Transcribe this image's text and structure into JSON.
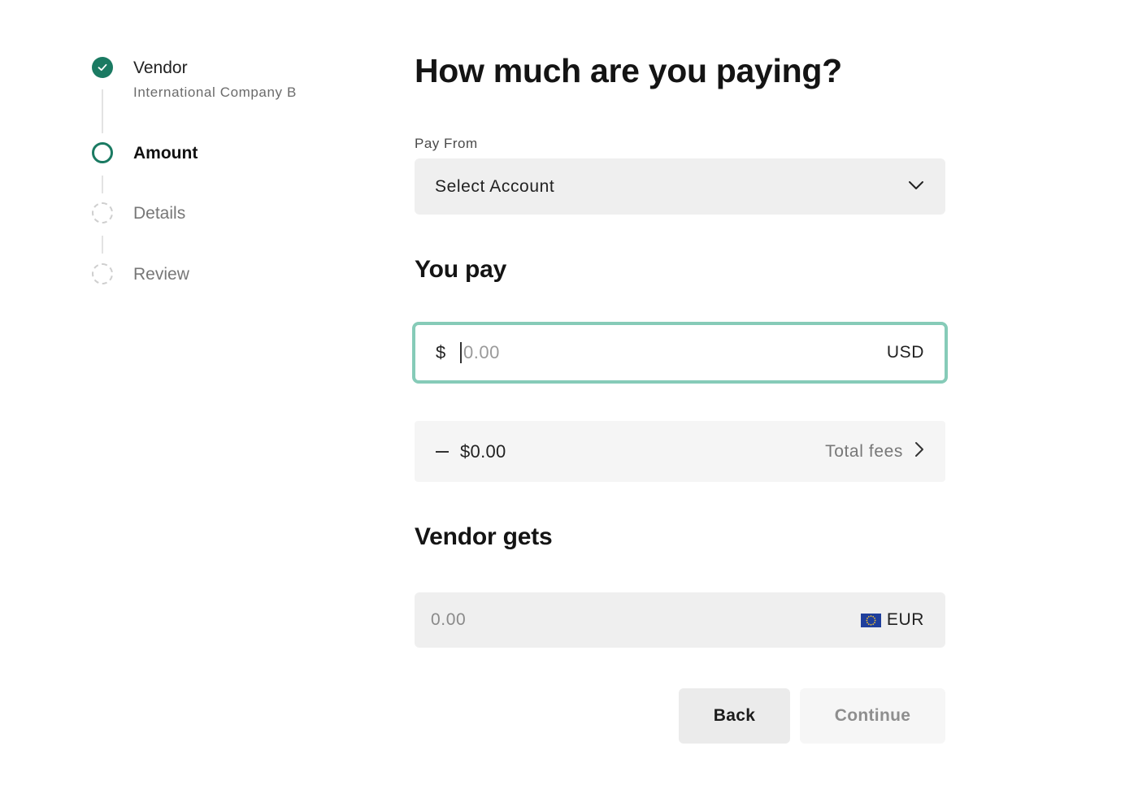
{
  "stepper": {
    "steps": [
      {
        "label": "Vendor",
        "sublabel": "International Company B",
        "status": "complete"
      },
      {
        "label": "Amount",
        "status": "current"
      },
      {
        "label": "Details",
        "status": "upcoming"
      },
      {
        "label": "Review",
        "status": "upcoming"
      }
    ]
  },
  "page": {
    "title": "How much are you paying?"
  },
  "pay_from": {
    "label": "Pay From",
    "selected": "Select Account"
  },
  "you_pay": {
    "title": "You pay",
    "currency_symbol": "$",
    "placeholder": "0.00",
    "currency_code": "USD"
  },
  "fees": {
    "amount": "$0.00",
    "label": "Total fees"
  },
  "vendor_gets": {
    "title": "Vendor gets",
    "value": "0.00",
    "currency_code": "EUR"
  },
  "actions": {
    "back_label": "Back",
    "continue_label": "Continue"
  },
  "colors": {
    "accent": "#1a7a62",
    "focus_border": "#86cbb8",
    "field_bg": "#efefef"
  }
}
